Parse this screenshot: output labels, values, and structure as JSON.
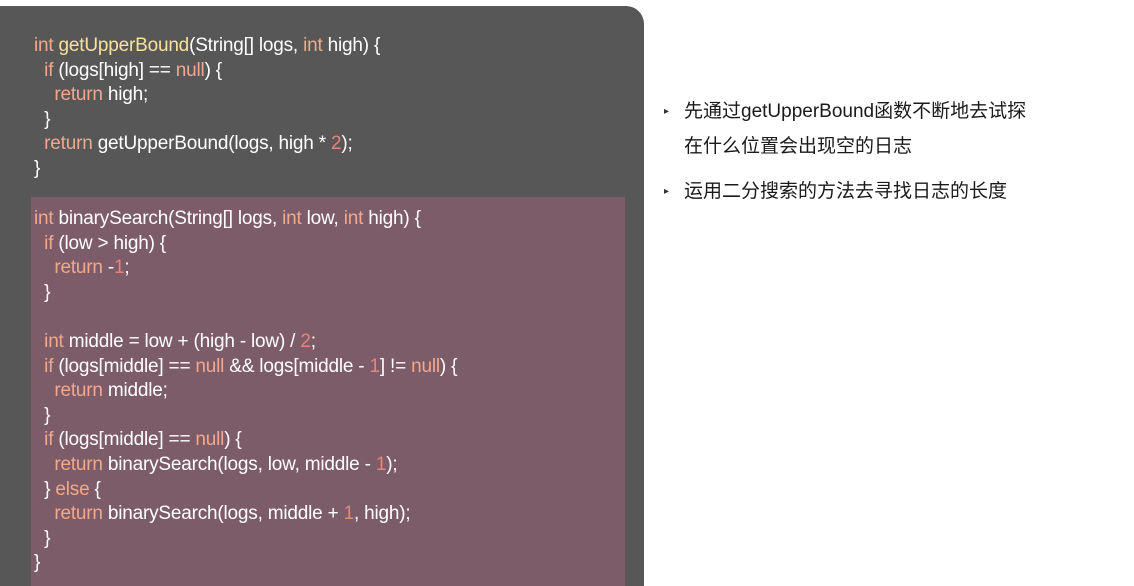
{
  "code1": [
    [
      [
        "kw",
        "int "
      ],
      [
        "fn",
        "getUpperBound"
      ],
      [
        "t",
        "(String[] logs, "
      ],
      [
        "kw",
        "int"
      ],
      [
        "t",
        " high) {"
      ]
    ],
    [
      [
        "t",
        "  "
      ],
      [
        "kw",
        "if"
      ],
      [
        "t",
        " (logs[high] == "
      ],
      [
        "kw",
        "null"
      ],
      [
        "t",
        ") {"
      ]
    ],
    [
      [
        "t",
        "    "
      ],
      [
        "kw",
        "return"
      ],
      [
        "t",
        " high;"
      ]
    ],
    [
      [
        "t",
        "  }"
      ]
    ],
    [
      [
        "t",
        "  "
      ],
      [
        "kw",
        "return"
      ],
      [
        "t",
        " getUpperBound(logs, high * "
      ],
      [
        "num",
        "2"
      ],
      [
        "t",
        ");"
      ]
    ],
    [
      [
        "t",
        "}"
      ]
    ]
  ],
  "code2": [
    [
      [
        "kw",
        "int"
      ],
      [
        "t",
        " binarySearch(String[] logs, "
      ],
      [
        "kw",
        "int"
      ],
      [
        "t",
        " low, "
      ],
      [
        "kw",
        "int"
      ],
      [
        "t",
        " high) {"
      ]
    ],
    [
      [
        "t",
        "  "
      ],
      [
        "kw",
        "if"
      ],
      [
        "t",
        " (low > high) {"
      ]
    ],
    [
      [
        "t",
        "    "
      ],
      [
        "kw",
        "return"
      ],
      [
        "t",
        " -"
      ],
      [
        "num",
        "1"
      ],
      [
        "t",
        ";"
      ]
    ],
    [
      [
        "t",
        "  }"
      ]
    ],
    [
      [
        "t",
        ""
      ]
    ],
    [
      [
        "t",
        "  "
      ],
      [
        "kw",
        "int"
      ],
      [
        "t",
        " middle = low + (high - low) / "
      ],
      [
        "num",
        "2"
      ],
      [
        "t",
        ";"
      ]
    ],
    [
      [
        "t",
        "  "
      ],
      [
        "kw",
        "if"
      ],
      [
        "t",
        " (logs[middle] == "
      ],
      [
        "kw",
        "null"
      ],
      [
        "t",
        " && logs[middle - "
      ],
      [
        "num",
        "1"
      ],
      [
        "t",
        "] != "
      ],
      [
        "kw",
        "null"
      ],
      [
        "t",
        ") {"
      ]
    ],
    [
      [
        "t",
        "    "
      ],
      [
        "kw",
        "return"
      ],
      [
        "t",
        " middle;"
      ]
    ],
    [
      [
        "t",
        "  }"
      ]
    ],
    [
      [
        "t",
        "  "
      ],
      [
        "kw",
        "if"
      ],
      [
        "t",
        " (logs[middle] == "
      ],
      [
        "kw",
        "null"
      ],
      [
        "t",
        ") {"
      ]
    ],
    [
      [
        "t",
        "    "
      ],
      [
        "kw",
        "return"
      ],
      [
        "t",
        " binarySearch(logs, low, middle - "
      ],
      [
        "num",
        "1"
      ],
      [
        "t",
        ");"
      ]
    ],
    [
      [
        "t",
        "  } "
      ],
      [
        "kw",
        "else"
      ],
      [
        "t",
        " {"
      ]
    ],
    [
      [
        "t",
        "    "
      ],
      [
        "kw",
        "return"
      ],
      [
        "t",
        " binarySearch(logs, middle + "
      ],
      [
        "num",
        "1"
      ],
      [
        "t",
        ", high);"
      ]
    ],
    [
      [
        "t",
        "  }"
      ]
    ],
    [
      [
        "t",
        "}"
      ]
    ]
  ],
  "bullets": {
    "marker": "▸",
    "items": [
      {
        "lines": [
          "先通过getUpperBound函数不断地去试探",
          "在什么位置会出现空的日志"
        ]
      },
      {
        "lines": [
          "运用二分搜索的方法去寻找日志的长度"
        ]
      }
    ]
  },
  "colors": {
    "panel": "#575757",
    "highlight": "#7d5c6a",
    "keyword": "#f2a88a",
    "function": "#f7e39a",
    "number": "#e8847a"
  }
}
